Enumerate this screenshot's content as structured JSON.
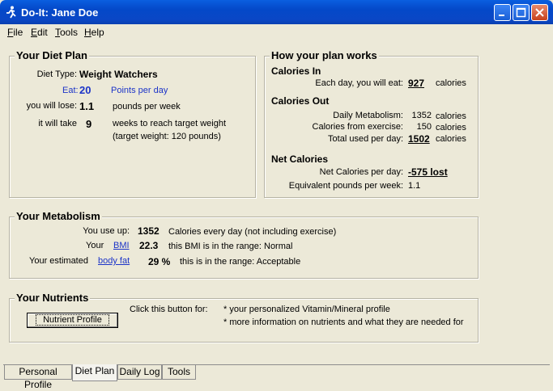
{
  "window": {
    "title": "Do-It: Jane Doe"
  },
  "menu": [
    "File",
    "Edit",
    "Tools",
    "Help"
  ],
  "diet_plan": {
    "title": "Your Diet Plan",
    "diet_type_label": "Diet Type:",
    "diet_type_value": "Weight Watchers",
    "eat_label": "Eat:",
    "eat_value": "20",
    "eat_unit": "Points per day",
    "lose_label": "you will lose:",
    "lose_value": "1.1",
    "lose_unit": "pounds per week",
    "take_label": "it will take",
    "take_value": "9",
    "take_unit": "weeks to reach target weight",
    "target_note": "(target weight:  120 pounds)"
  },
  "how_plan": {
    "title": "How your plan works",
    "calories_in_heading": "Calories In",
    "eat_label": "Each day, you will eat:",
    "eat_value": "927",
    "eat_unit": "calories",
    "calories_out_heading": "Calories Out",
    "metabolism_label": "Daily Metabolism:",
    "metabolism_value": "1352",
    "metabolism_unit": "calories",
    "exercise_label": "Calories from exercise:",
    "exercise_value": "150",
    "exercise_unit": "calories",
    "total_label": "Total used per day:",
    "total_value": "1502",
    "total_unit": "calories",
    "net_heading": "Net Calories",
    "net_label": "Net Calories per day:",
    "net_value": "-575 lost",
    "equiv_label": "Equivalent pounds per week:",
    "equiv_value": "1.1"
  },
  "metabolism": {
    "title": "Your Metabolism",
    "use_label": "You use up:",
    "use_value": "1352",
    "use_note": "Calories every day (not including exercise)",
    "your_label": "Your",
    "bmi_link": "BMI",
    "bmi_value": "22.3",
    "bmi_note": "this BMI is in the range: Normal",
    "estimated_label": "Your estimated",
    "bodyfat_link": "body fat",
    "bodyfat_value": "29 %",
    "bodyfat_note": "this is in the range:  Acceptable"
  },
  "nutrients": {
    "title": "Your Nutrients",
    "button_label": "Nutrient Profile",
    "click_text": "Click this button for:",
    "bullet1": "* your personalized Vitamin/Mineral profile",
    "bullet2": "* more information on nutrients and what they are needed for"
  },
  "tabs": [
    "Personal Profile",
    "Diet Plan",
    "Daily Log",
    "Tools"
  ]
}
